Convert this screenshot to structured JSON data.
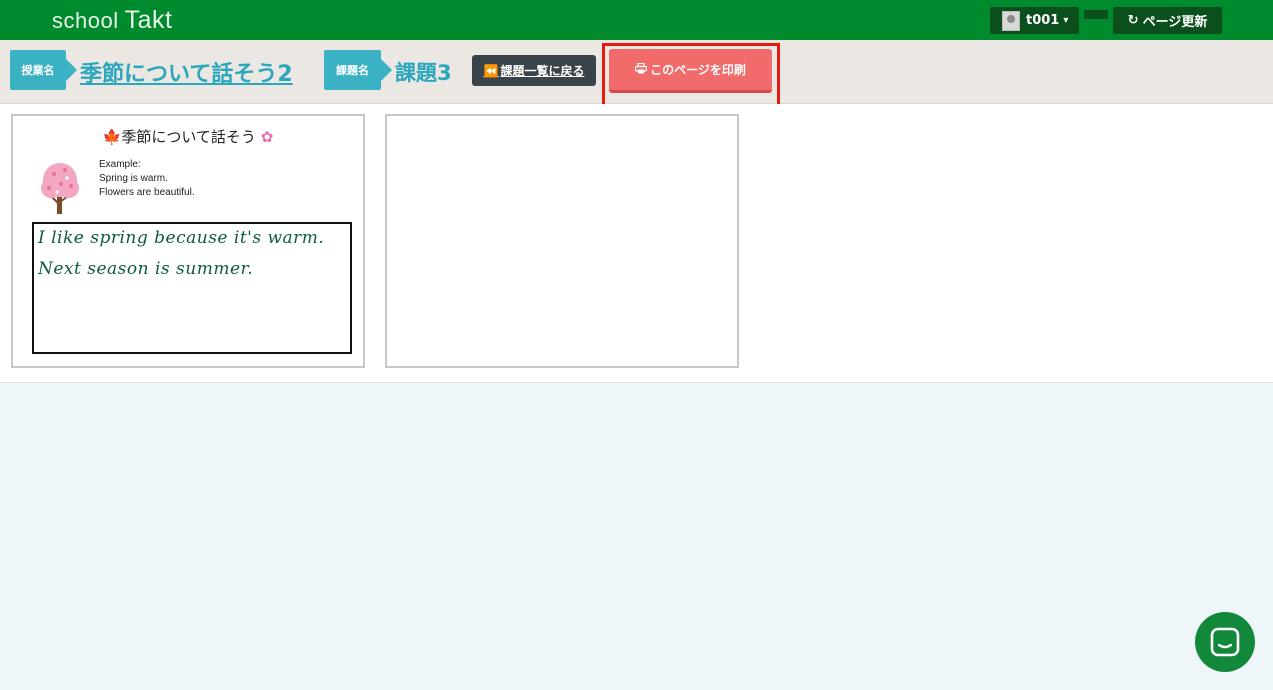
{
  "header": {
    "logo_school": "school",
    "logo_takt": "Takt",
    "user_label": "t001",
    "refresh_label": "ページ更新"
  },
  "breadcrumb": {
    "lesson_tag": "授業名",
    "lesson_title": "季節について話そう2",
    "assignment_tag": "課題名",
    "assignment_title": "課題3",
    "back_label": "課題一覧に戻る",
    "print_label": "このページを印刷"
  },
  "cards": [
    {
      "title": "季節について話そう",
      "example_lines": [
        "Example:",
        "Spring is warm.",
        "Flowers are beautiful."
      ],
      "handwriting": [
        "I like spring because it's warm.",
        "Next season is summer."
      ]
    },
    {
      "title": "",
      "example_lines": [],
      "handwriting": []
    }
  ],
  "colors": {
    "header_green": "#008a2e",
    "accent_teal": "#3bb1c4",
    "print_red": "#f26b6b",
    "highlight_red": "#e8190f"
  }
}
